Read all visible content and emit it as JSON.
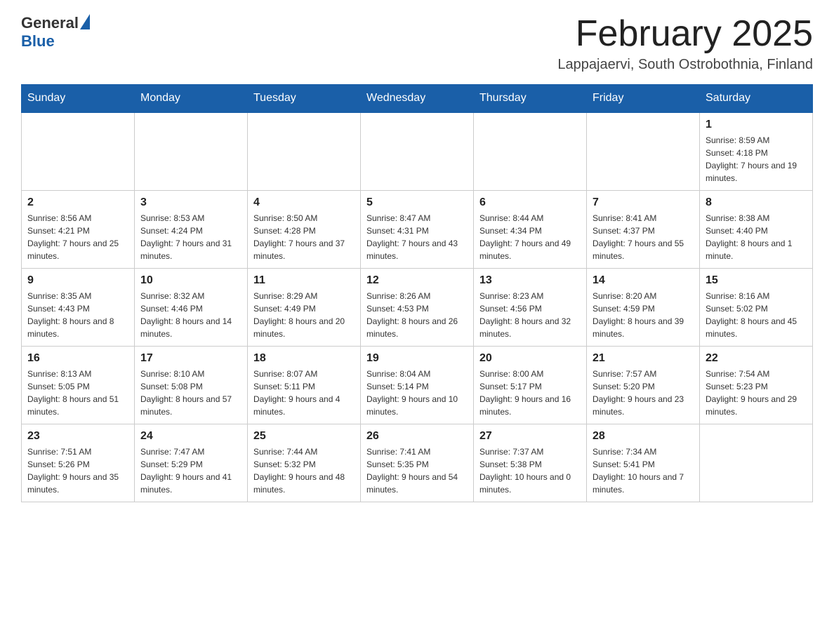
{
  "logo": {
    "general": "General",
    "blue": "Blue"
  },
  "title": "February 2025",
  "subtitle": "Lappajaervi, South Ostrobothnia, Finland",
  "weekdays": [
    "Sunday",
    "Monday",
    "Tuesday",
    "Wednesday",
    "Thursday",
    "Friday",
    "Saturday"
  ],
  "weeks": [
    [
      {
        "day": "",
        "sunrise": "",
        "sunset": "",
        "daylight": ""
      },
      {
        "day": "",
        "sunrise": "",
        "sunset": "",
        "daylight": ""
      },
      {
        "day": "",
        "sunrise": "",
        "sunset": "",
        "daylight": ""
      },
      {
        "day": "",
        "sunrise": "",
        "sunset": "",
        "daylight": ""
      },
      {
        "day": "",
        "sunrise": "",
        "sunset": "",
        "daylight": ""
      },
      {
        "day": "",
        "sunrise": "",
        "sunset": "",
        "daylight": ""
      },
      {
        "day": "1",
        "sunrise": "Sunrise: 8:59 AM",
        "sunset": "Sunset: 4:18 PM",
        "daylight": "Daylight: 7 hours and 19 minutes."
      }
    ],
    [
      {
        "day": "2",
        "sunrise": "Sunrise: 8:56 AM",
        "sunset": "Sunset: 4:21 PM",
        "daylight": "Daylight: 7 hours and 25 minutes."
      },
      {
        "day": "3",
        "sunrise": "Sunrise: 8:53 AM",
        "sunset": "Sunset: 4:24 PM",
        "daylight": "Daylight: 7 hours and 31 minutes."
      },
      {
        "day": "4",
        "sunrise": "Sunrise: 8:50 AM",
        "sunset": "Sunset: 4:28 PM",
        "daylight": "Daylight: 7 hours and 37 minutes."
      },
      {
        "day": "5",
        "sunrise": "Sunrise: 8:47 AM",
        "sunset": "Sunset: 4:31 PM",
        "daylight": "Daylight: 7 hours and 43 minutes."
      },
      {
        "day": "6",
        "sunrise": "Sunrise: 8:44 AM",
        "sunset": "Sunset: 4:34 PM",
        "daylight": "Daylight: 7 hours and 49 minutes."
      },
      {
        "day": "7",
        "sunrise": "Sunrise: 8:41 AM",
        "sunset": "Sunset: 4:37 PM",
        "daylight": "Daylight: 7 hours and 55 minutes."
      },
      {
        "day": "8",
        "sunrise": "Sunrise: 8:38 AM",
        "sunset": "Sunset: 4:40 PM",
        "daylight": "Daylight: 8 hours and 1 minute."
      }
    ],
    [
      {
        "day": "9",
        "sunrise": "Sunrise: 8:35 AM",
        "sunset": "Sunset: 4:43 PM",
        "daylight": "Daylight: 8 hours and 8 minutes."
      },
      {
        "day": "10",
        "sunrise": "Sunrise: 8:32 AM",
        "sunset": "Sunset: 4:46 PM",
        "daylight": "Daylight: 8 hours and 14 minutes."
      },
      {
        "day": "11",
        "sunrise": "Sunrise: 8:29 AM",
        "sunset": "Sunset: 4:49 PM",
        "daylight": "Daylight: 8 hours and 20 minutes."
      },
      {
        "day": "12",
        "sunrise": "Sunrise: 8:26 AM",
        "sunset": "Sunset: 4:53 PM",
        "daylight": "Daylight: 8 hours and 26 minutes."
      },
      {
        "day": "13",
        "sunrise": "Sunrise: 8:23 AM",
        "sunset": "Sunset: 4:56 PM",
        "daylight": "Daylight: 8 hours and 32 minutes."
      },
      {
        "day": "14",
        "sunrise": "Sunrise: 8:20 AM",
        "sunset": "Sunset: 4:59 PM",
        "daylight": "Daylight: 8 hours and 39 minutes."
      },
      {
        "day": "15",
        "sunrise": "Sunrise: 8:16 AM",
        "sunset": "Sunset: 5:02 PM",
        "daylight": "Daylight: 8 hours and 45 minutes."
      }
    ],
    [
      {
        "day": "16",
        "sunrise": "Sunrise: 8:13 AM",
        "sunset": "Sunset: 5:05 PM",
        "daylight": "Daylight: 8 hours and 51 minutes."
      },
      {
        "day": "17",
        "sunrise": "Sunrise: 8:10 AM",
        "sunset": "Sunset: 5:08 PM",
        "daylight": "Daylight: 8 hours and 57 minutes."
      },
      {
        "day": "18",
        "sunrise": "Sunrise: 8:07 AM",
        "sunset": "Sunset: 5:11 PM",
        "daylight": "Daylight: 9 hours and 4 minutes."
      },
      {
        "day": "19",
        "sunrise": "Sunrise: 8:04 AM",
        "sunset": "Sunset: 5:14 PM",
        "daylight": "Daylight: 9 hours and 10 minutes."
      },
      {
        "day": "20",
        "sunrise": "Sunrise: 8:00 AM",
        "sunset": "Sunset: 5:17 PM",
        "daylight": "Daylight: 9 hours and 16 minutes."
      },
      {
        "day": "21",
        "sunrise": "Sunrise: 7:57 AM",
        "sunset": "Sunset: 5:20 PM",
        "daylight": "Daylight: 9 hours and 23 minutes."
      },
      {
        "day": "22",
        "sunrise": "Sunrise: 7:54 AM",
        "sunset": "Sunset: 5:23 PM",
        "daylight": "Daylight: 9 hours and 29 minutes."
      }
    ],
    [
      {
        "day": "23",
        "sunrise": "Sunrise: 7:51 AM",
        "sunset": "Sunset: 5:26 PM",
        "daylight": "Daylight: 9 hours and 35 minutes."
      },
      {
        "day": "24",
        "sunrise": "Sunrise: 7:47 AM",
        "sunset": "Sunset: 5:29 PM",
        "daylight": "Daylight: 9 hours and 41 minutes."
      },
      {
        "day": "25",
        "sunrise": "Sunrise: 7:44 AM",
        "sunset": "Sunset: 5:32 PM",
        "daylight": "Daylight: 9 hours and 48 minutes."
      },
      {
        "day": "26",
        "sunrise": "Sunrise: 7:41 AM",
        "sunset": "Sunset: 5:35 PM",
        "daylight": "Daylight: 9 hours and 54 minutes."
      },
      {
        "day": "27",
        "sunrise": "Sunrise: 7:37 AM",
        "sunset": "Sunset: 5:38 PM",
        "daylight": "Daylight: 10 hours and 0 minutes."
      },
      {
        "day": "28",
        "sunrise": "Sunrise: 7:34 AM",
        "sunset": "Sunset: 5:41 PM",
        "daylight": "Daylight: 10 hours and 7 minutes."
      },
      {
        "day": "",
        "sunrise": "",
        "sunset": "",
        "daylight": ""
      }
    ]
  ]
}
